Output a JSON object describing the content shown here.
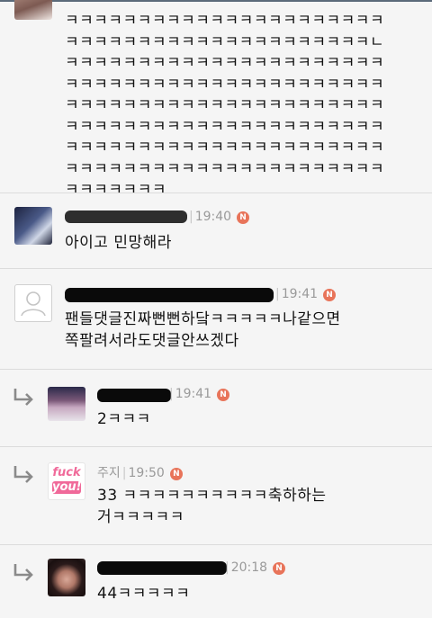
{
  "comments": [
    {
      "id": 1,
      "text": "ㅋㅋㅋㅋㅋㅋㅋㅋㅋㅋㅋㅋㅋㅋㅋㅋㅋㅋㅋㅋㅋㅋ\nㅋㅋㅋㅋㅋㅋㅋㅋㅋㅋㅋㅋㅋㅋㅋㅋㅋㅋㅋㅋㅋㄴ\nㅋㅋㅋㅋㅋㅋㅋㅋㅋㅋㅋㅋㅋㅋㅋㅋㅋㅋㅋㅋㅋㅋ\nㅋㅋㅋㅋㅋㅋㅋㅋㅋㅋㅋㅋㅋㅋㅋㅋㅋㅋㅋㅋㅋㅋ\nㅋㅋㅋㅋㅋㅋㅋㅋㅋㅋㅋㅋㅋㅋㅋㅋㅋㅋㅋㅋㅋㅋ\nㅋㅋㅋㅋㅋㅋㅋㅋㅋㅋㅋㅋㅋㅋㅋㅋㅋㅋㅋㅋㅋㅋ\nㅋㅋㅋㅋㅋㅋㅋㅋㅋㅋㅋㅋㅋㅋㅋㅋㅋㅋㅋㅋㅋㅋ\nㅋㅋㅋㅋㅋㅋㅋㅋㅋㅋㅋㅋㅋㅋㅋㅋㅋㅋㅋㅋㅋㅋ\nㅋㅋㅋㅋㅋㅋㅋ"
    },
    {
      "id": 2,
      "time": "19:40",
      "badge": "N",
      "text": "아이고 민망해라",
      "avatar": "photo-avatar"
    },
    {
      "id": 3,
      "time": "19:41",
      "badge": "N",
      "text": "팬들댓글진짜뻔뻔하닼ㅋㅋㅋㅋㅋ나같으면\n쪽팔려서라도댓글안쓰겠다",
      "avatar": "default-user-avatar"
    },
    {
      "id": 4,
      "reply": true,
      "time": "19:41",
      "badge": "N",
      "text": "2ㅋㅋㅋ",
      "avatar": "stage-photo-avatar"
    },
    {
      "id": 5,
      "reply": true,
      "name": "주지",
      "time": "19:50",
      "badge": "N",
      "text": "33 ㅋㅋㅋㅋㅋㅋㅋㅋㅋㅋ축하하는\n거ㅋㅋㅋㅋㅋ",
      "avatar": "sticker-avatar",
      "avatar_text_1": "fuck",
      "avatar_text_2": "you!"
    },
    {
      "id": 6,
      "reply": true,
      "time": "20:18",
      "badge": "N",
      "text": "44ㅋㅋㅋㅋㅋ",
      "avatar": "portrait-avatar"
    }
  ],
  "colors": {
    "badge": "#e8745a",
    "meta": "#9a9a9a",
    "divider": "#dcdcdc",
    "reply_arrow": "#8a8a8a"
  }
}
